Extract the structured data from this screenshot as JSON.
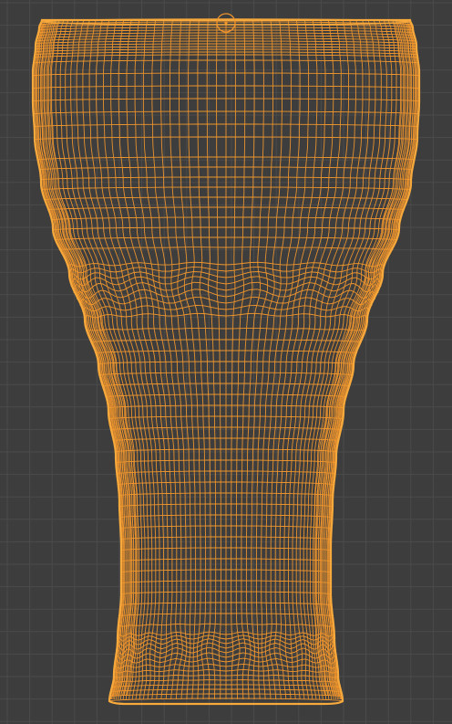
{
  "viewport": {
    "mode": "wireframe",
    "background_color": "#3d3d3d",
    "grid_color": "#4b4b4b",
    "grid": true
  },
  "object": {
    "name_hint": "glass",
    "wire_color": "#f0962d",
    "outline_color": "#f7a93c",
    "origin_marker": true
  }
}
